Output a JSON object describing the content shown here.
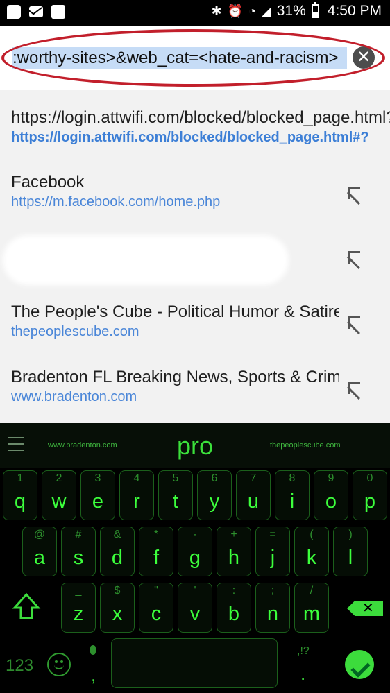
{
  "status_bar": {
    "battery": "31%",
    "time": "4:50 PM"
  },
  "url_bar": {
    "text": ":worthy-sites>&web_cat=<hate-and-racism>"
  },
  "suggestions": [
    {
      "title": "https://login.attwifi.com/blocked/blocked_page.html?",
      "url": "https://login.attwifi.com/blocked/blocked_page.html#?"
    },
    {
      "title": "Facebook",
      "url": "https://m.facebook.com/home.php"
    },
    {
      "title": "",
      "url": ""
    },
    {
      "title": "The People's Cube - Political Humor & Satire",
      "url": "thepeoplescube.com"
    },
    {
      "title": "Bradenton FL Breaking News, Sports & Crime",
      "url": "www.bradenton.com"
    }
  ],
  "keyboard": {
    "suggestion_left": "www.bradenton.com",
    "suggestion_center": "pro",
    "suggestion_right": "thepeoplescube.com",
    "row1": [
      {
        "hint": "1",
        "key": "q"
      },
      {
        "hint": "2",
        "key": "w"
      },
      {
        "hint": "3",
        "key": "e"
      },
      {
        "hint": "4",
        "key": "r"
      },
      {
        "hint": "5",
        "key": "t"
      },
      {
        "hint": "6",
        "key": "y"
      },
      {
        "hint": "7",
        "key": "u"
      },
      {
        "hint": "8",
        "key": "i"
      },
      {
        "hint": "9",
        "key": "o"
      },
      {
        "hint": "0",
        "key": "p"
      }
    ],
    "row2": [
      {
        "hint": "@",
        "key": "a"
      },
      {
        "hint": "#",
        "key": "s"
      },
      {
        "hint": "&",
        "key": "d"
      },
      {
        "hint": "*",
        "key": "f"
      },
      {
        "hint": "-",
        "key": "g"
      },
      {
        "hint": "+",
        "key": "h"
      },
      {
        "hint": "=",
        "key": "j"
      },
      {
        "hint": "(",
        "key": "k"
      },
      {
        "hint": ")",
        "key": "l"
      }
    ],
    "row3": [
      {
        "hint": "_",
        "key": "z"
      },
      {
        "hint": "$",
        "key": "x"
      },
      {
        "hint": "\"",
        "key": "c"
      },
      {
        "hint": "'",
        "key": "v"
      },
      {
        "hint": ":",
        "key": "b"
      },
      {
        "hint": ";",
        "key": "n"
      },
      {
        "hint": "/",
        "key": "m"
      }
    ],
    "num_label": "123",
    "comma": ",",
    "punct_hint": ",!?",
    "period": "."
  }
}
